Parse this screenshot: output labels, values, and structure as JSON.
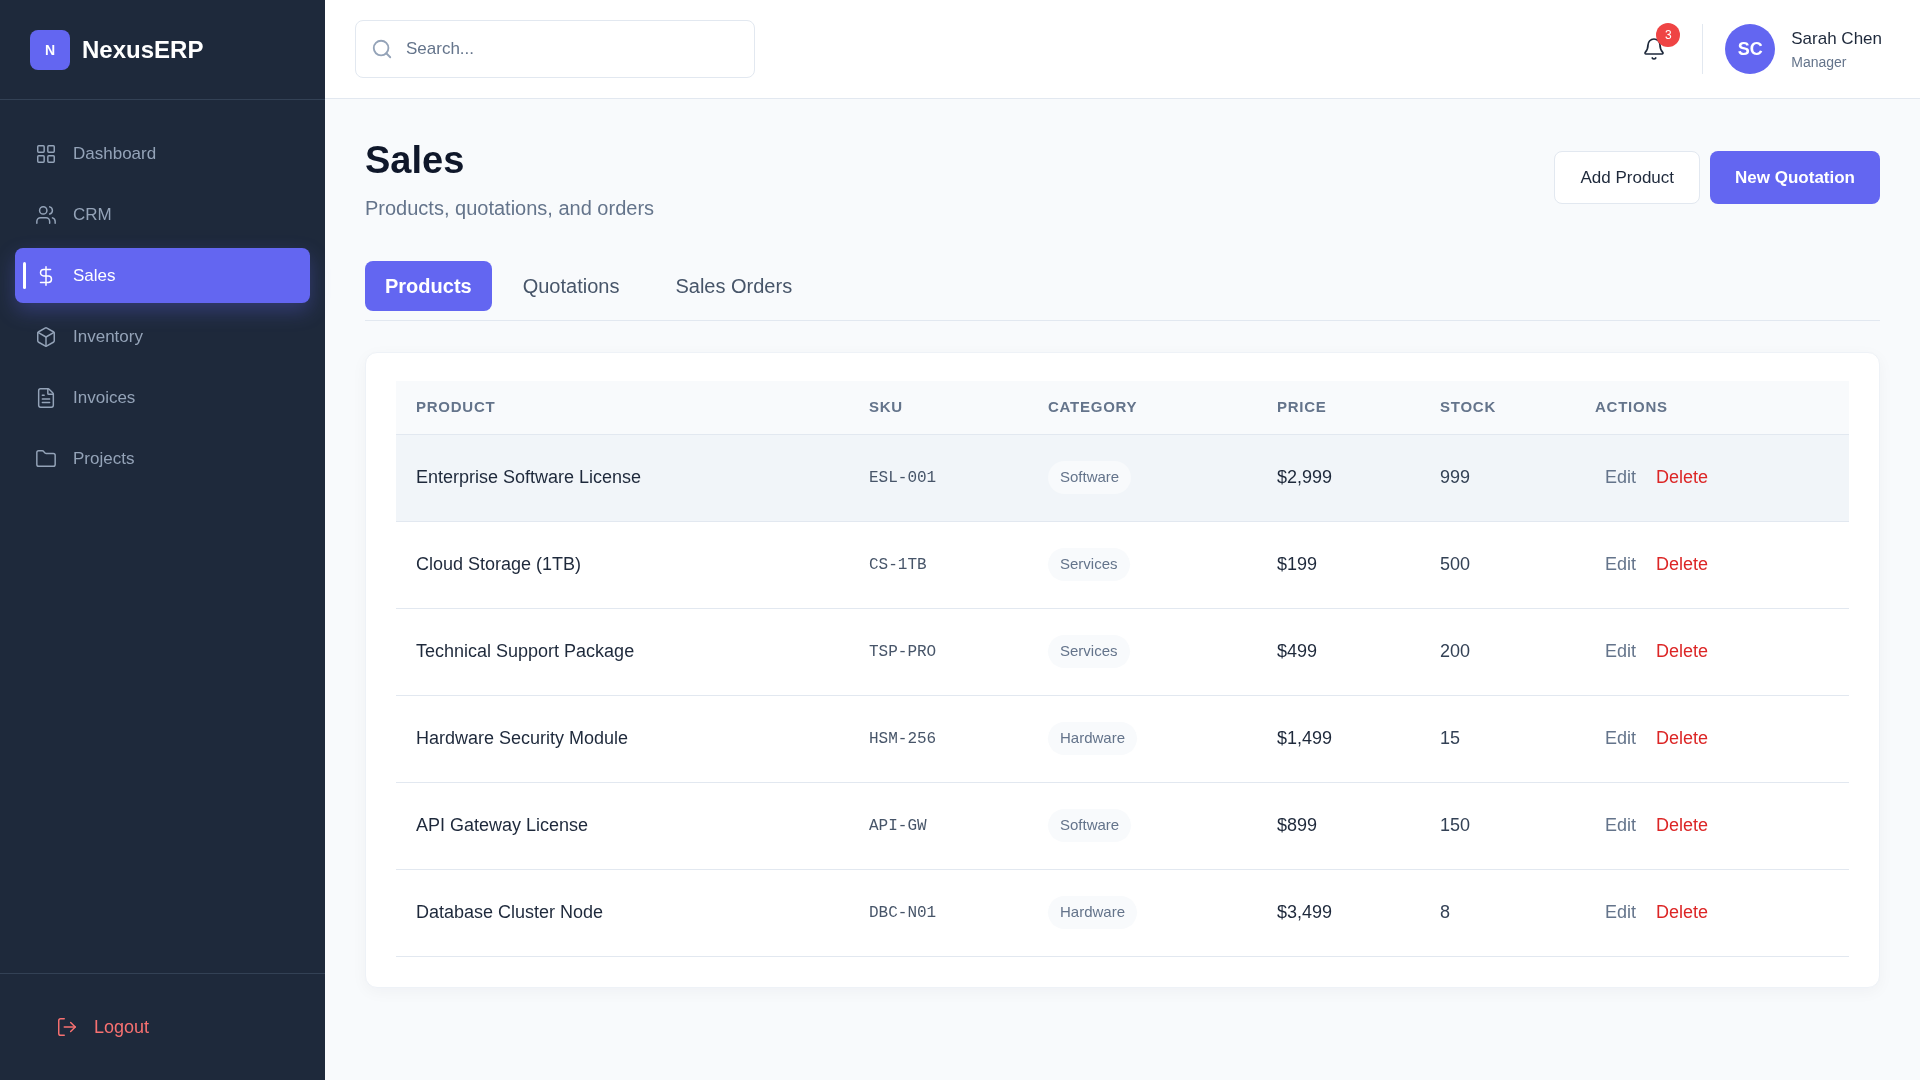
{
  "sidebar": {
    "logo_letter": "N",
    "brand": "NexusERP",
    "items": [
      {
        "label": "Dashboard",
        "selected": false
      },
      {
        "label": "CRM",
        "selected": false
      },
      {
        "label": "Sales",
        "selected": true
      },
      {
        "label": "Inventory",
        "selected": false
      },
      {
        "label": "Invoices",
        "selected": false
      },
      {
        "label": "Projects",
        "selected": false
      }
    ],
    "logout": "Logout"
  },
  "header": {
    "search": {
      "placeholder": "Search..."
    },
    "notifications": "3",
    "user": {
      "initials": "SC",
      "name": "Sarah Chen",
      "role": "Manager"
    }
  },
  "page": {
    "title": "Sales",
    "subtitle": "Products, quotations, and orders",
    "buttons": [
      {
        "label": "Add Product",
        "kind": "secondary"
      },
      {
        "label": "New Quotation",
        "kind": "primary"
      }
    ]
  },
  "tabs": [
    {
      "label": "Products",
      "selected": true
    },
    {
      "label": "Quotations",
      "selected": false
    },
    {
      "label": "Sales Orders",
      "selected": false
    }
  ],
  "table": {
    "columns": [
      "PRODUCT",
      "SKU",
      "CATEGORY",
      "PRICE",
      "STOCK",
      "ACTIONS"
    ],
    "rows": [
      {
        "product": "Enterprise Software License",
        "sku": "ESL-001",
        "category": "Software",
        "price": "$2,999",
        "stock": "999",
        "actions": [
          "Edit",
          "Delete"
        ],
        "selected": true
      },
      {
        "product": "Cloud Storage (1TB)",
        "sku": "CS-1TB",
        "category": "Services",
        "price": "$199",
        "stock": "500",
        "actions": [
          "Edit",
          "Delete"
        ],
        "selected": false
      },
      {
        "product": "Technical Support Package",
        "sku": "TSP-PRO",
        "category": "Services",
        "price": "$499",
        "stock": "200",
        "actions": [
          "Edit",
          "Delete"
        ],
        "selected": false
      },
      {
        "product": "Hardware Security Module",
        "sku": "HSM-256",
        "category": "Hardware",
        "price": "$1,499",
        "stock": "15",
        "actions": [
          "Edit",
          "Delete"
        ],
        "selected": false
      },
      {
        "product": "API Gateway License",
        "sku": "API-GW",
        "category": "Software",
        "price": "$899",
        "stock": "150",
        "actions": [
          "Edit",
          "Delete"
        ],
        "selected": false
      },
      {
        "product": "Database Cluster Node",
        "sku": "DBC-N01",
        "category": "Hardware",
        "price": "$3,499",
        "stock": "8",
        "actions": [
          "Edit",
          "Delete"
        ],
        "selected": false
      }
    ]
  }
}
